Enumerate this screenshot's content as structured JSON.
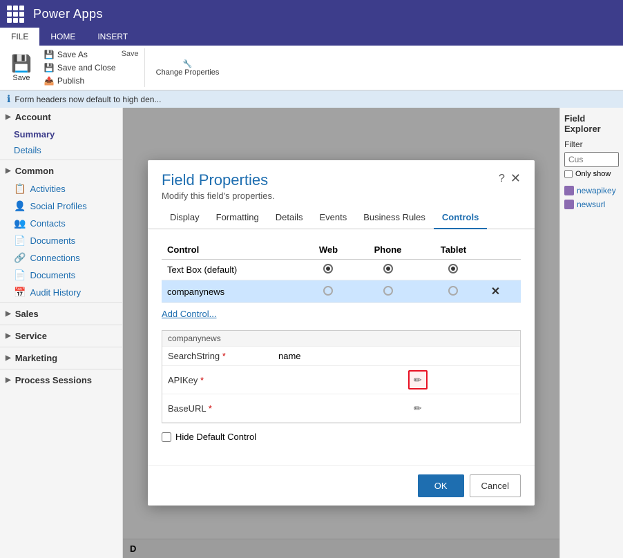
{
  "app": {
    "title": "Power Apps"
  },
  "ribbon": {
    "tabs": [
      "FILE",
      "HOME",
      "INSERT"
    ],
    "active_tab": "HOME",
    "save_label": "Save",
    "save_as_label": "Save As",
    "save_close_label": "Save and Close",
    "publish_label": "Publish",
    "change_properties_label": "Change\nProperties",
    "group_label": "Save"
  },
  "info_bar": {
    "message": "Form headers now default to high den..."
  },
  "sidebar": {
    "account_section": "Account",
    "summary_label": "Summary",
    "details_label": "Details",
    "common_section": "Common",
    "activities_label": "Activities",
    "social_profiles_label": "Social Profiles",
    "contacts_label": "Contacts",
    "documents_label": "Documents",
    "connections_label": "Connections",
    "documents2_label": "Documents",
    "audit_history_label": "Audit History",
    "sales_section": "Sales",
    "service_section": "Service",
    "marketing_section": "Marketing",
    "process_sessions_section": "Process Sessions"
  },
  "right_panel": {
    "title": "Field Explorer",
    "filter_label": "Filter",
    "filter_placeholder": "Cus",
    "only_show_label": "Only show",
    "items": [
      {
        "label": "newapikey"
      },
      {
        "label": "newsurl"
      }
    ]
  },
  "modal": {
    "title": "Field Properties",
    "subtitle": "Modify this field's properties.",
    "tabs": [
      "Display",
      "Formatting",
      "Details",
      "Events",
      "Business Rules",
      "Controls"
    ],
    "active_tab": "Controls",
    "table": {
      "headers": [
        "Control",
        "Web",
        "Phone",
        "Tablet"
      ],
      "rows": [
        {
          "control": "Text Box (default)",
          "web": "checked",
          "phone": "checked",
          "tablet": "checked",
          "selected": false,
          "deletable": false
        },
        {
          "control": "companynews",
          "web": "empty",
          "phone": "empty",
          "tablet": "empty",
          "selected": true,
          "deletable": true
        }
      ]
    },
    "add_control_label": "Add Control...",
    "property_section_title": "companynews",
    "properties": [
      {
        "name": "SearchString",
        "required": true,
        "value": "name",
        "has_edit": false
      },
      {
        "name": "APIKey",
        "required": true,
        "value": "",
        "has_edit": true,
        "edit_highlighted": true
      },
      {
        "name": "BaseURL",
        "required": true,
        "value": "",
        "has_edit": true,
        "edit_highlighted": false
      }
    ],
    "hide_default_label": "Hide Default Control",
    "ok_label": "OK",
    "cancel_label": "Cancel"
  },
  "bottom": {
    "label": "D"
  }
}
